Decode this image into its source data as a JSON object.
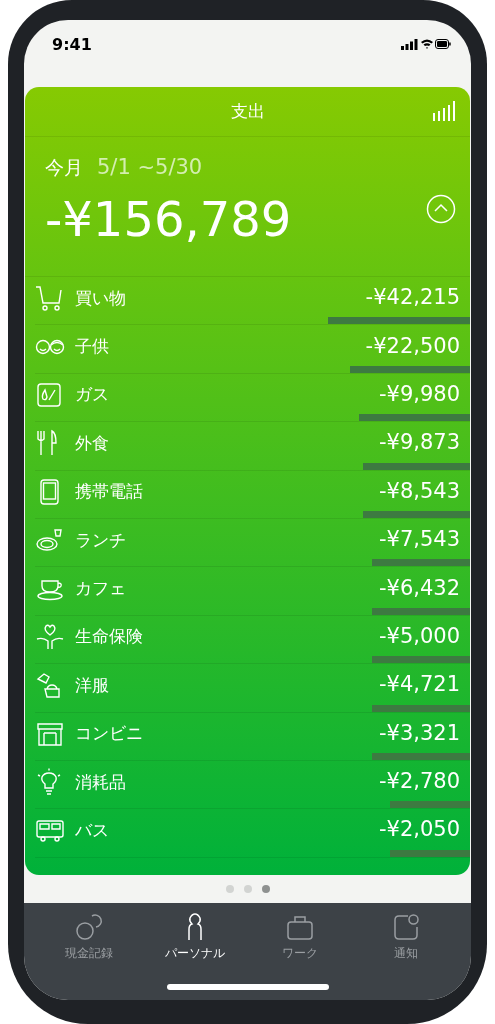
{
  "status_bar": {
    "time": "9:41"
  },
  "card": {
    "title": "支出",
    "period_label": "今月",
    "period_range": "5/1 ~5/30",
    "total": "-¥156,789",
    "expanded": true
  },
  "categories": [
    {
      "name": "買い物",
      "amount": "-¥42,215",
      "level": 0.32
    },
    {
      "name": "子供",
      "amount": "-¥22,500",
      "level": 0.27
    },
    {
      "name": "ガス",
      "amount": "-¥9,980",
      "level": 0.25
    },
    {
      "name": "外食",
      "amount": "-¥9,873",
      "level": 0.24
    },
    {
      "name": "携帯電話",
      "amount": "-¥8,543",
      "level": 0.24
    },
    {
      "name": "ランチ",
      "amount": "-¥7,543",
      "level": 0.22
    },
    {
      "name": "カフェ",
      "amount": "-¥6,432",
      "level": 0.22
    },
    {
      "name": "生命保険",
      "amount": "-¥5,000",
      "level": 0.22
    },
    {
      "name": "洋服",
      "amount": "-¥4,721",
      "level": 0.22
    },
    {
      "name": "コンビニ",
      "amount": "-¥3,321",
      "level": 0.22
    },
    {
      "name": "消耗品",
      "amount": "-¥2,780",
      "level": 0.18
    },
    {
      "name": "バス",
      "amount": "-¥2,050",
      "level": 0.18
    }
  ],
  "pages": [
    {
      "selected": false
    },
    {
      "selected": false
    },
    {
      "selected": true
    }
  ],
  "tabs": [
    {
      "label": "現金記録",
      "selected": false
    },
    {
      "label": "パーソナル",
      "selected": true
    },
    {
      "label": "ワーク",
      "selected": false
    },
    {
      "label": "通知",
      "selected": false
    }
  ]
}
